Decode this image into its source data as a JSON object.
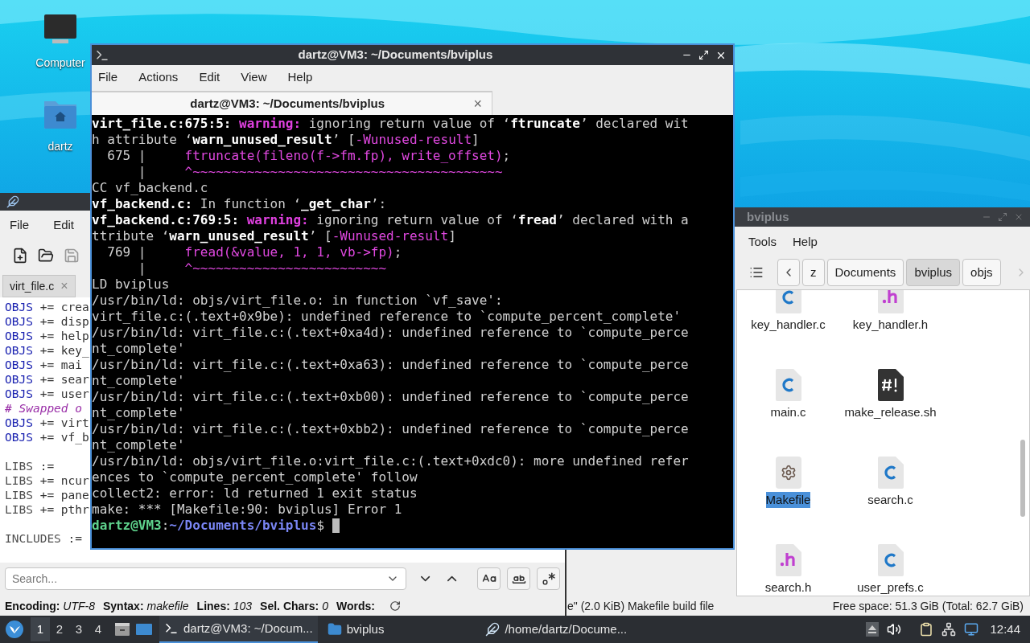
{
  "desktop_icons": [
    {
      "label": "Computer",
      "kind": "computer"
    },
    {
      "label": "dartz",
      "kind": "home"
    }
  ],
  "editor": {
    "menu": [
      "File",
      "Edit"
    ],
    "tab": {
      "label": "virt_file.c",
      "close": "×"
    },
    "code_lines": [
      {
        "kind": "objs",
        "var": "OBJS",
        "rest": " += crea"
      },
      {
        "kind": "objs",
        "var": "OBJS",
        "rest": " += disp"
      },
      {
        "kind": "objs",
        "var": "OBJS",
        "rest": " += help"
      },
      {
        "kind": "objs",
        "var": "OBJS",
        "rest": " += key_"
      },
      {
        "kind": "objs",
        "var": "OBJS",
        "rest": " += mai"
      },
      {
        "kind": "objs",
        "var": "OBJS",
        "rest": " += sear"
      },
      {
        "kind": "objs",
        "var": "OBJS",
        "rest": " += user"
      },
      {
        "kind": "comment",
        "var": "# Swapped o"
      },
      {
        "kind": "objs",
        "var": "OBJS",
        "rest": " += virt"
      },
      {
        "kind": "objs",
        "var": "OBJS",
        "rest": " += vf_b"
      },
      {
        "kind": "blank"
      },
      {
        "kind": "libs",
        "var": "LIBS",
        "rest": " :="
      },
      {
        "kind": "libs",
        "var": "LIBS",
        "rest": " += ncur"
      },
      {
        "kind": "libs",
        "var": "LIBS",
        "rest": " += pane"
      },
      {
        "kind": "libs",
        "var": "LIBS",
        "rest": " += pthr"
      },
      {
        "kind": "blank"
      },
      {
        "kind": "libs",
        "var": "INCLUDES",
        "rest": " :="
      }
    ],
    "search": {
      "placeholder": "Search..."
    },
    "status": [
      {
        "label": "Encoding:",
        "value": "UTF-8"
      },
      {
        "label": "Syntax:",
        "value": "makefile"
      },
      {
        "label": "Lines:",
        "value": "103"
      },
      {
        "label": "Sel. Chars:",
        "value": "0"
      },
      {
        "label": "Words:"
      }
    ]
  },
  "terminal": {
    "title": "dartz@VM3: ~/Documents/bviplus",
    "menu": [
      "File",
      "Actions",
      "Edit",
      "View",
      "Help"
    ],
    "tab": {
      "label": "dartz@VM3: ~/Documents/bviplus",
      "close": "×"
    },
    "lines": [
      {
        "segments": [
          {
            "kind": "bold",
            "text": "virt_file.c:675:5: "
          },
          {
            "kind": "warning",
            "text": "warning: "
          },
          {
            "kind": "normal",
            "text": "ignoring return value of ‘"
          },
          {
            "kind": "bold",
            "text": "ftruncate"
          },
          {
            "kind": "normal",
            "text": "’ declared wit"
          }
        ]
      },
      {
        "segments": [
          {
            "kind": "normal",
            "text": "h attribute ‘"
          },
          {
            "kind": "bold",
            "text": "warn_unused_result"
          },
          {
            "kind": "normal",
            "text": "’ ["
          },
          {
            "kind": "highlight",
            "text": "-Wunused-result"
          },
          {
            "kind": "normal",
            "text": "]"
          }
        ]
      },
      {
        "segments": [
          {
            "kind": "normal",
            "text": "  675 |     "
          },
          {
            "kind": "highlight",
            "text": "ftruncate(fileno(f->fm.fp), write_offset)"
          },
          {
            "kind": "normal",
            "text": ";"
          }
        ]
      },
      {
        "segments": [
          {
            "kind": "normal",
            "text": "      |     "
          },
          {
            "kind": "highlight",
            "text": "^~~~~~~~~~~~~~~~~~~~~~~~~~~~~~~~~~~~~~~~~"
          }
        ]
      },
      {
        "segments": [
          {
            "kind": "normal",
            "text": "CC vf_backend.c"
          }
        ]
      },
      {
        "segments": [
          {
            "kind": "bold",
            "text": "vf_backend.c:"
          },
          {
            "kind": "normal",
            "text": " In function ‘"
          },
          {
            "kind": "bold",
            "text": "_get_char"
          },
          {
            "kind": "normal",
            "text": "’:"
          }
        ]
      },
      {
        "segments": [
          {
            "kind": "bold",
            "text": "vf_backend.c:769:5: "
          },
          {
            "kind": "warning",
            "text": "warning: "
          },
          {
            "kind": "normal",
            "text": "ignoring return value of ‘"
          },
          {
            "kind": "bold",
            "text": "fread"
          },
          {
            "kind": "normal",
            "text": "’ declared with a"
          }
        ]
      },
      {
        "segments": [
          {
            "kind": "normal",
            "text": "ttribute ‘"
          },
          {
            "kind": "bold",
            "text": "warn_unused_result"
          },
          {
            "kind": "normal",
            "text": "’ ["
          },
          {
            "kind": "highlight",
            "text": "-Wunused-result"
          },
          {
            "kind": "normal",
            "text": "]"
          }
        ]
      },
      {
        "segments": [
          {
            "kind": "normal",
            "text": "  769 |     "
          },
          {
            "kind": "highlight",
            "text": "fread(&value, 1, 1, vb->fp)"
          },
          {
            "kind": "normal",
            "text": ";"
          }
        ]
      },
      {
        "segments": [
          {
            "kind": "normal",
            "text": "      |     "
          },
          {
            "kind": "highlight",
            "text": "^~~~~~~~~~~~~~~~~~~~~~~~~~"
          }
        ]
      },
      {
        "segments": [
          {
            "kind": "normal",
            "text": "LD bviplus"
          }
        ]
      },
      {
        "segments": [
          {
            "kind": "normal",
            "text": "/usr/bin/ld: objs/virt_file.o: in function `vf_save':"
          }
        ]
      },
      {
        "segments": [
          {
            "kind": "normal",
            "text": "virt_file.c:(.text+0x9be): undefined reference to `compute_percent_complete'"
          }
        ]
      },
      {
        "segments": [
          {
            "kind": "normal",
            "text": "/usr/bin/ld: virt_file.c:(.text+0xa4d): undefined reference to `compute_perce"
          }
        ]
      },
      {
        "segments": [
          {
            "kind": "normal",
            "text": "nt_complete'"
          }
        ]
      },
      {
        "segments": [
          {
            "kind": "normal",
            "text": "/usr/bin/ld: virt_file.c:(.text+0xa63): undefined reference to `compute_perce"
          }
        ]
      },
      {
        "segments": [
          {
            "kind": "normal",
            "text": "nt_complete'"
          }
        ]
      },
      {
        "segments": [
          {
            "kind": "normal",
            "text": "/usr/bin/ld: virt_file.c:(.text+0xb00): undefined reference to `compute_perce"
          }
        ]
      },
      {
        "segments": [
          {
            "kind": "normal",
            "text": "nt_complete'"
          }
        ]
      },
      {
        "segments": [
          {
            "kind": "normal",
            "text": "/usr/bin/ld: virt_file.c:(.text+0xbb2): undefined reference to `compute_perce"
          }
        ]
      },
      {
        "segments": [
          {
            "kind": "normal",
            "text": "nt_complete'"
          }
        ]
      },
      {
        "segments": [
          {
            "kind": "normal",
            "text": "/usr/bin/ld: objs/virt_file.o:virt_file.c:(.text+0xdc0): more undefined refer"
          }
        ]
      },
      {
        "segments": [
          {
            "kind": "normal",
            "text": "ences to `compute_percent_complete' follow"
          }
        ]
      },
      {
        "segments": [
          {
            "kind": "normal",
            "text": "collect2: error: ld returned 1 exit status"
          }
        ]
      },
      {
        "segments": [
          {
            "kind": "normal",
            "text": "make: *** [Makefile:90: bviplus] Error 1"
          }
        ]
      },
      {
        "segments": [
          {
            "kind": "user",
            "text": "dartz@VM3"
          },
          {
            "kind": "normal",
            "text": ":"
          },
          {
            "kind": "path",
            "text": "~/Documents/bviplus"
          },
          {
            "kind": "normal",
            "text": "$ "
          }
        ],
        "cursor": true
      }
    ]
  },
  "file_manager": {
    "title": "bviplus",
    "menu": [
      "Tools",
      "Help"
    ],
    "path": [
      {
        "label": "z",
        "selected": false
      },
      {
        "label": "Documents",
        "selected": false
      },
      {
        "label": "bviplus",
        "selected": true
      },
      {
        "label": "objs",
        "selected": false
      }
    ],
    "files": [
      {
        "name": "key_handler.c",
        "kind": "c_source",
        "selected": false
      },
      {
        "name": "key_handler.h",
        "kind": "header",
        "selected": false
      },
      {
        "name": "main.c",
        "kind": "c_source",
        "selected": false
      },
      {
        "name": "make_release.sh",
        "kind": "script",
        "selected": false
      },
      {
        "name": "Makefile",
        "kind": "makefile",
        "selected": true
      },
      {
        "name": "search.c",
        "kind": "c_source",
        "selected": false
      },
      {
        "name": "search.h",
        "kind": "header",
        "selected": false
      },
      {
        "name": "user_prefs.c",
        "kind": "c_source",
        "selected": false
      }
    ],
    "status_left": "e\" (2.0 KiB) Makefile build file",
    "status_right": "Free space: 51.3 GiB (Total: 62.7 GiB)"
  },
  "taskbar": {
    "workspaces": [
      {
        "label": "1",
        "selected": true
      },
      {
        "label": "2",
        "selected": false
      },
      {
        "label": "3",
        "selected": false
      },
      {
        "label": "4",
        "selected": false
      }
    ],
    "tasks": [
      {
        "label": "dartz@VM3: ~/Docum...",
        "kind": "terminal",
        "selected": true
      },
      {
        "label": "bviplus",
        "kind": "folder",
        "selected": false
      },
      {
        "label": "/home/dartz/Docume...",
        "kind": "editor",
        "selected": false
      }
    ],
    "clock": "12:44"
  }
}
